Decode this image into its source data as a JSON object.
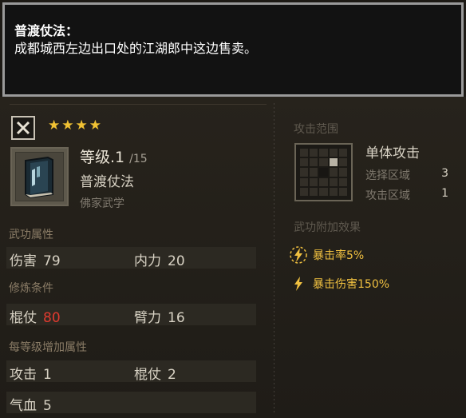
{
  "tooltip": {
    "title": "普渡仗法：",
    "body": "成都城西左边出口处的江湖郎中这边售卖。"
  },
  "skill": {
    "stars": "★★★★",
    "level_label": "等级.1",
    "level_max": "/15",
    "name": "普渡仗法",
    "school": "佛家武学",
    "icon": "book-icon"
  },
  "sections": {
    "attributes": "武功属性",
    "requirements": "修炼条件",
    "per_level": "每等级增加属性"
  },
  "attributes": [
    {
      "label": "伤害",
      "value": "79"
    },
    {
      "label": "内力",
      "value": "20"
    }
  ],
  "requirements": [
    {
      "label": "棍仗",
      "value": "80",
      "color": "#e03a2f"
    },
    {
      "label": "臂力",
      "value": "16"
    }
  ],
  "per_level": [
    {
      "label": "攻击",
      "value": "1"
    },
    {
      "label": "棍仗",
      "value": "2"
    },
    {
      "label": "气血",
      "value": "5"
    }
  ],
  "range": {
    "header": "攻击范围",
    "target_type": "单体攻击",
    "select_label": "选择区域",
    "select_value": "3",
    "attack_label": "攻击区域",
    "attack_value": "1"
  },
  "effects": {
    "header": "武功附加效果",
    "items": [
      {
        "text": "暴击率5%",
        "icon": "lightning-icon",
        "highlighted": true
      },
      {
        "text": "暴击伤害150%",
        "icon": "lightning-icon",
        "highlighted": false
      }
    ]
  },
  "colors": {
    "stars": "#f1c233",
    "effect_text": "#f0c040",
    "warning_value": "#e03a2f"
  }
}
